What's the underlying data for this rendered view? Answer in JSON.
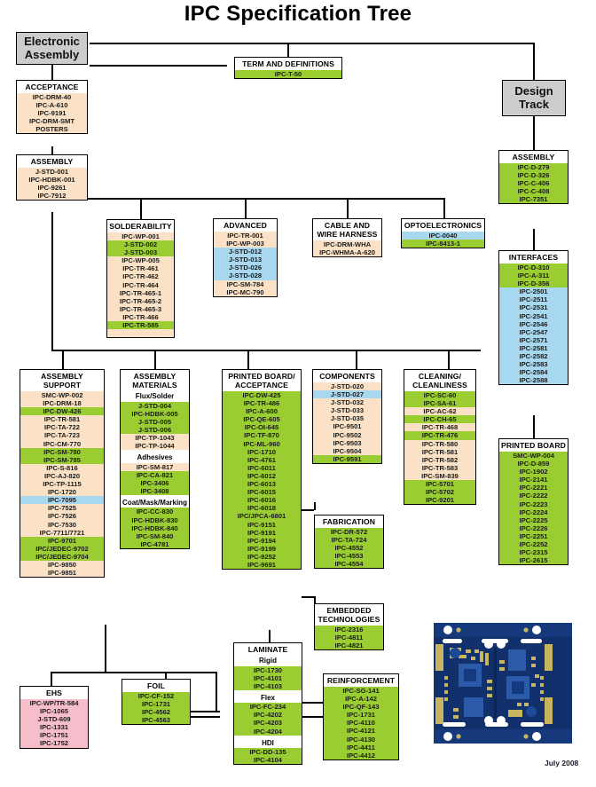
{
  "title": "IPC Specification Tree",
  "date_label": "July 2008",
  "colors": {
    "green": "#9acd32",
    "peach": "#fbe2c6",
    "blue": "#a8d8f0",
    "pink": "#f6bdcb",
    "root_grey": "#cccccc",
    "border": "#000000"
  },
  "roots": {
    "electronic_assembly": "Electronic\nAssembly",
    "electronic_assembly_line1": "Electronic",
    "electronic_assembly_line2": "Assembly",
    "design_track_line1": "Design",
    "design_track_line2": "Track"
  },
  "nodes": {
    "term_definitions": {
      "header": "TERM AND DEFINITIONS",
      "groups": [
        {
          "color": "green",
          "items": [
            "IPC-T-50"
          ]
        }
      ]
    },
    "acceptance": {
      "header": "ACCEPTANCE",
      "groups": [
        {
          "color": "peach",
          "items": [
            "IPC-DRM-40",
            "IPC-A-610",
            "IPC-9191",
            "IPC-DRM-SMT",
            "POSTERS"
          ]
        }
      ]
    },
    "assembly_left": {
      "header": "ASSEMBLY",
      "groups": [
        {
          "color": "peach",
          "items": [
            "J-STD-001",
            "IPC-HDBK-001",
            "IPC-9261",
            "IPC-7912"
          ]
        }
      ]
    },
    "solderability": {
      "header": "SOLDERABILITY",
      "groups": [
        {
          "color": "peach",
          "items": [
            "IPC-WP-001"
          ]
        },
        {
          "color": "green",
          "items": [
            "J-STD-002",
            "J-STD-003"
          ]
        },
        {
          "color": "peach",
          "items": [
            "IPC-WP-005",
            "IPC-TR-461",
            "IPC-TR-462",
            "IPC-TR-464",
            "IPC-TR-465-1",
            "IPC-TR-465-2",
            "IPC-TR-465-3",
            "IPC-TR-466"
          ]
        },
        {
          "color": "green",
          "items": [
            "IPC-TR-585"
          ]
        },
        {
          "color": "peach",
          "items": [
            ""
          ]
        }
      ]
    },
    "advanced": {
      "header": "ADVANCED",
      "groups": [
        {
          "color": "peach",
          "items": [
            "IPC-TR-001",
            "IPC-WP-003"
          ]
        },
        {
          "color": "blue",
          "items": [
            "J-STD-012",
            "J-STD-013",
            "J-STD-026",
            "J-STD-028"
          ]
        },
        {
          "color": "peach",
          "items": [
            "IPC-SM-784",
            "IPC-MC-790"
          ]
        }
      ]
    },
    "cable_wire_harness": {
      "header": "CABLE AND\nWIRE HARNESS",
      "header_line1": "CABLE AND",
      "header_line2": "WIRE HARNESS",
      "groups": [
        {
          "color": "peach",
          "items": [
            "IPC-DRM-WHA",
            "IPC-WHMA-A-620"
          ]
        }
      ]
    },
    "optoelectronics": {
      "header": "OPTOELECTRONICS",
      "groups": [
        {
          "color": "blue",
          "items": [
            "IPC-0040"
          ]
        },
        {
          "color": "green",
          "items": [
            "IPC-8413-1"
          ]
        }
      ]
    },
    "assembly_right": {
      "header": "ASSEMBLY",
      "groups": [
        {
          "color": "green",
          "items": [
            "IPC-D-279",
            "IPC-D-326",
            "IPC-C-406",
            "IPC-C-408",
            "IPC-7351"
          ]
        }
      ]
    },
    "interfaces": {
      "header": "INTERFACES",
      "groups": [
        {
          "color": "green",
          "items": [
            "IPC-D-310",
            "IPC-A-311",
            "IPC-D-356"
          ]
        },
        {
          "color": "blue",
          "items": [
            "IPC-2501",
            "IPC-2511",
            "IPC-2531",
            "IPC-2541",
            "IPC-2546",
            "IPC-2547",
            "IPC-2571",
            "IPC-2581",
            "IPC-2582",
            "IPC-2583",
            "IPC-2584",
            "IPC-2588"
          ]
        }
      ]
    },
    "printed_board": {
      "header": "PRINTED BOARD",
      "groups": [
        {
          "color": "green",
          "items": [
            "SMC-WP-004",
            "IPC-D-859",
            "IPC-1902",
            "IPC-2141",
            "IPC-2221",
            "IPC-2222",
            "IPC-2223",
            "IPC-2224",
            "IPC-2225",
            "IPC-2226",
            "IPC-2251",
            "IPC-2252",
            "IPC-2315",
            "IPC-2615"
          ]
        }
      ]
    },
    "assembly_support": {
      "header": "ASSEMBLY\nSUPPORT",
      "header_line1": "ASSEMBLY",
      "header_line2": "SUPPORT",
      "groups": [
        {
          "color": "peach",
          "items": [
            "SMC-WP-002",
            "IPC-DRM-18"
          ]
        },
        {
          "color": "green",
          "items": [
            "IPC-DW-426"
          ]
        },
        {
          "color": "peach",
          "items": [
            "IPC-TR-581",
            "IPC-TA-722",
            "IPC-TA-723",
            "IPC-CM-770"
          ]
        },
        {
          "color": "green",
          "items": [
            "IPC-SM-780",
            "IPC-SM-785"
          ]
        },
        {
          "color": "peach",
          "items": [
            "IPC-S-816",
            "IPC-AJ-820",
            "IPC-TP-1115",
            "IPC-1720"
          ]
        },
        {
          "color": "blue",
          "items": [
            "IPC-7095"
          ]
        },
        {
          "color": "peach",
          "items": [
            "IPC-7525",
            "IPC-7526",
            "IPC-7530",
            "IPC-7711/7721"
          ]
        },
        {
          "color": "green",
          "items": [
            "IPC-9701",
            "IPC/JEDEC-9702",
            "IPC/JEDEC-9704"
          ]
        },
        {
          "color": "peach",
          "items": [
            "IPC-9850",
            "IPC-9851"
          ]
        }
      ]
    },
    "assembly_materials": {
      "header": "ASSEMBLY\nMATERIALS",
      "header_line1": "ASSEMBLY",
      "header_line2": "MATERIALS",
      "sub1": "Flux/Solder",
      "sub2": "Adhesives",
      "sub3": "Coat/Mask/Marking",
      "groups": [
        {
          "color": "green",
          "items": [
            "J-STD-004",
            "IPC-HDBK-005",
            "J-STD-005",
            "J-STD-006"
          ]
        },
        {
          "color": "peach",
          "items": [
            "IPC-TP-1043",
            "IPC-TP-1044"
          ]
        },
        {
          "color": "peach",
          "items": [
            "IPC-SM-817"
          ]
        },
        {
          "color": "green",
          "items": [
            "IPC-CA-821",
            "IPC-3406",
            "IPC-3408"
          ]
        },
        {
          "color": "green",
          "items": [
            "IPC-CC-830",
            "IPC-HDBK-830",
            "IPC-HDBK-840",
            "IPC-SM-840",
            "IPC-4781"
          ]
        }
      ]
    },
    "printed_board_acceptance": {
      "header": "PRINTED BOARD/\nACCEPTANCE",
      "header_line1": "PRINTED BOARD/",
      "header_line2": "ACCEPTANCE",
      "groups": [
        {
          "color": "green",
          "items": [
            "IPC-DW-425",
            "IPC-TR-486",
            "IPC-A-600",
            "IPC-QE-605",
            "IPC-OI-645",
            "IPC-TF-870",
            "IPC-ML-960",
            "IPC-1710",
            "IPC-4761",
            "IPC-6011",
            "IPC-6012",
            "IPC-6013",
            "IPC-6015",
            "IPC-6016",
            "IPC-6018",
            "IPC/JPCA-6801",
            "IPC-9151",
            "IPC-9191",
            "IPC-9194",
            "IPC-9199",
            "IPC-9252",
            "IPC-9691"
          ]
        }
      ]
    },
    "components": {
      "header": "COMPONENTS",
      "groups": [
        {
          "color": "peach",
          "items": [
            "J-STD-020"
          ]
        },
        {
          "color": "blue",
          "items": [
            "J-STD-027"
          ]
        },
        {
          "color": "peach",
          "items": [
            "J-STD-032",
            "J-STD-033",
            "J-STD-035",
            "IPC-9501",
            "IPC-9502",
            "IPC-9503",
            "IPC-9504"
          ]
        },
        {
          "color": "green",
          "items": [
            "IPC-9591"
          ]
        }
      ]
    },
    "cleaning_cleanliness": {
      "header": "CLEANING/\nCLEANLINESS",
      "header_line1": "CLEANING/",
      "header_line2": "CLEANLINESS",
      "groups": [
        {
          "color": "green",
          "items": [
            "IPC-SC-60",
            "IPC-SA-61"
          ]
        },
        {
          "color": "peach",
          "items": [
            "IPC-AC-62"
          ]
        },
        {
          "color": "green",
          "items": [
            "IPC-CH-65"
          ]
        },
        {
          "color": "peach",
          "items": [
            "IPC-TR-468"
          ]
        },
        {
          "color": "green",
          "items": [
            "IPC-TR-476"
          ]
        },
        {
          "color": "peach",
          "items": [
            "IPC-TR-580",
            "IPC-TR-581",
            "IPC-TR-582",
            "IPC-TR-583",
            "IPC-SM-839"
          ]
        },
        {
          "color": "green",
          "items": [
            "IPC-5701",
            "IPC-5702",
            "IPC-9201"
          ]
        }
      ]
    },
    "fabrication": {
      "header": "FABRICATION",
      "groups": [
        {
          "color": "green",
          "items": [
            "IPC-DR-572",
            "IPC-TA-724",
            "IPC-4552",
            "IPC-4553",
            "IPC-4554"
          ]
        }
      ]
    },
    "embedded_technologies": {
      "header": "EMBEDDED\nTECHNOLOGIES",
      "header_line1": "EMBEDDED",
      "header_line2": "TECHNOLOGIES",
      "groups": [
        {
          "color": "green",
          "items": [
            "IPC-2316",
            "IPC-4811",
            "IPC-4821"
          ]
        }
      ]
    },
    "laminate": {
      "header": "LAMINATE",
      "sub1": "Rigid",
      "sub2": "Flex",
      "sub3": "HDI",
      "groups": [
        {
          "color": "green",
          "items": [
            "IPC-1730",
            "IPC-4101",
            "IPC-4103"
          ]
        },
        {
          "color": "green",
          "items": [
            "IPC-FC-234",
            "IPC-4202",
            "IPC-4203",
            "IPC-4204"
          ]
        },
        {
          "color": "green",
          "items": [
            "IPC-DD-135",
            "IPC-4104"
          ]
        }
      ]
    },
    "reinforcement": {
      "header": "REINFORCEMENT",
      "groups": [
        {
          "color": "green",
          "items": [
            "IPC-SG-141",
            "IPC-A-142",
            "IPC-QF-143",
            "IPC-1731",
            "IPC-4110",
            "IPC-4121",
            "IPC-4130",
            "IPC-4411",
            "IPC-4412"
          ]
        }
      ]
    },
    "foil": {
      "header": "FOIL",
      "groups": [
        {
          "color": "green",
          "items": [
            "IPC-CF-152",
            "IPC-1731",
            "IPC-4562",
            "IPC-4563"
          ]
        }
      ]
    },
    "ehs": {
      "header": "EHS",
      "groups": [
        {
          "color": "pink",
          "items": [
            "IPC-WP/TR-584",
            "IPC-1065",
            "J-STD-609",
            "IPC-1331",
            "IPC-1751",
            "IPC-1752"
          ]
        }
      ]
    }
  }
}
